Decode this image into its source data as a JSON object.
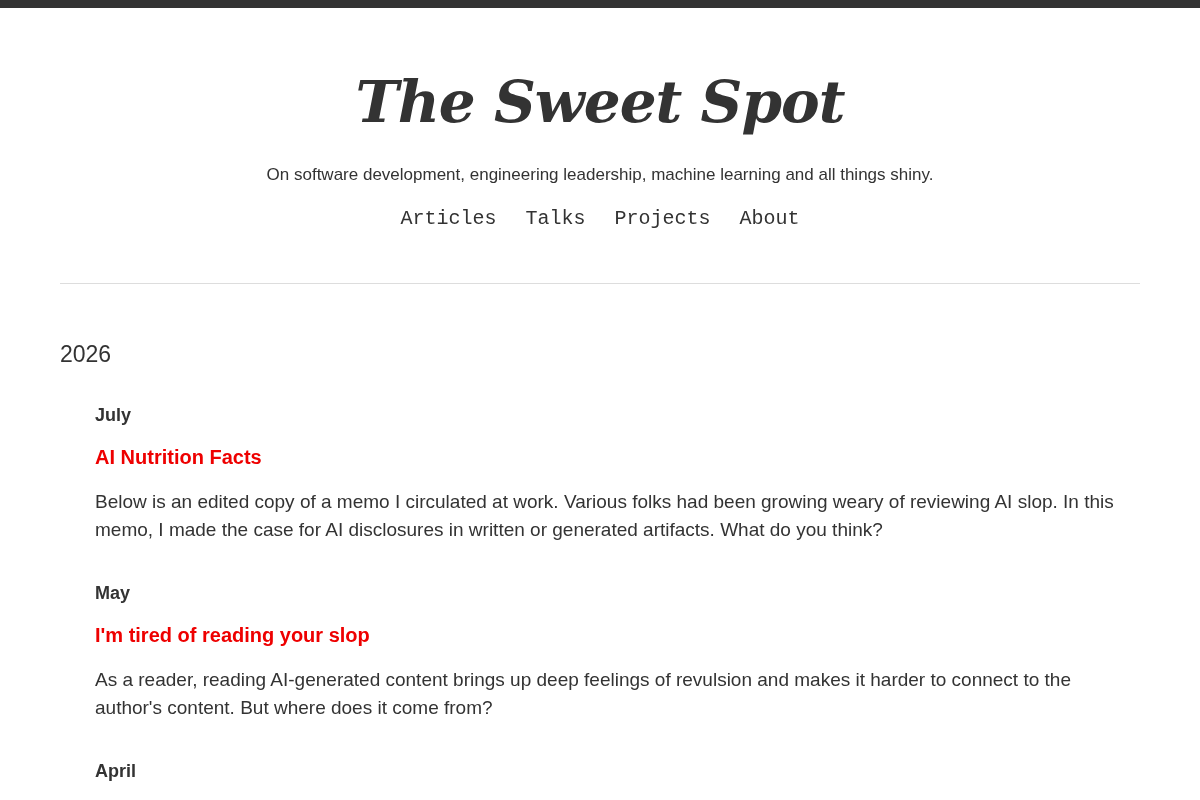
{
  "site": {
    "title": "The Sweet Spot",
    "tagline": "On software development, engineering leadership, machine learning and all things shiny."
  },
  "nav": [
    "Articles",
    "Talks",
    "Projects",
    "About"
  ],
  "archive": [
    {
      "year": "2026",
      "months": [
        {
          "month": "July",
          "posts": [
            {
              "title": "AI Nutrition Facts",
              "summary": "Below is an edited copy of a memo I circulated at work. Various folks had been growing weary of reviewing AI slop. In this memo, I made the case for AI disclosures in written or generated artifacts. What do you think?"
            }
          ]
        },
        {
          "month": "May",
          "posts": [
            {
              "title": "I'm tired of reading your slop",
              "summary": "As a reader, reading AI-generated content brings up deep feelings of revulsion and makes it harder to connect to the author's content. But where does it come from?"
            }
          ]
        },
        {
          "month": "April"
        }
      ]
    }
  ]
}
